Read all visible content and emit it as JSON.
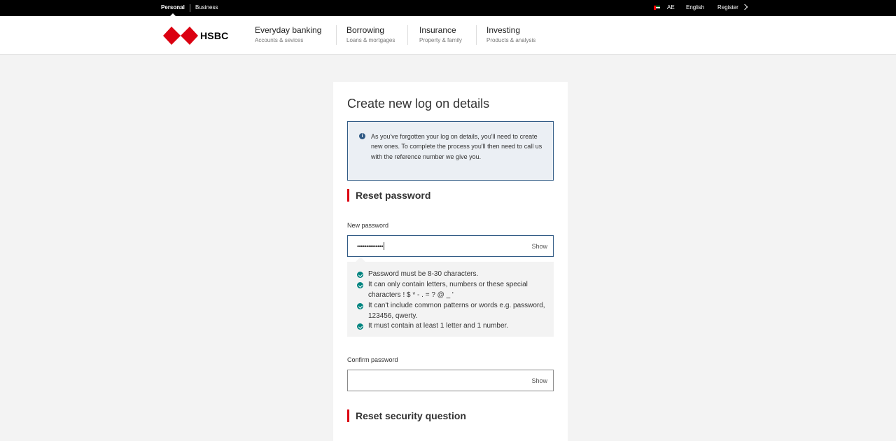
{
  "topbar": {
    "personal": "Personal",
    "business": "Business",
    "region": "AE",
    "language": "English",
    "register": "Register"
  },
  "header": {
    "brand": "HSBC",
    "nav": [
      {
        "title": "Everyday banking",
        "subtitle": "Accounts & sevices"
      },
      {
        "title": "Borrowing",
        "subtitle": "Loans & mortgages"
      },
      {
        "title": "Insurance",
        "subtitle": "Property & family"
      },
      {
        "title": "Investing",
        "subtitle": "Products & analysis"
      }
    ]
  },
  "form": {
    "title": "Create new log on details",
    "info": "As you've forgotten your log on details, you'll need to create new ones. To complete the process you'll then need to call us with the reference number we give you.",
    "reset_password_heading": "Reset password",
    "new_password_label": "New password",
    "new_password_value": "••••••••••••••",
    "show_label": "Show",
    "rules": [
      "Password must be 8-30 characters.",
      "It can only contain letters, numbers or these special characters ! $ * - . = ? @ _ '",
      "It can't include common patterns or words e.g. password, 123456, qwerty.",
      "It must contain at least 1 letter and 1 number."
    ],
    "confirm_password_label": "Confirm password",
    "confirm_password_value": "",
    "reset_security_heading": "Reset security question"
  },
  "colors": {
    "brand_red": "#db0011",
    "info_blue": "#305a85",
    "success_teal": "#00847f"
  }
}
